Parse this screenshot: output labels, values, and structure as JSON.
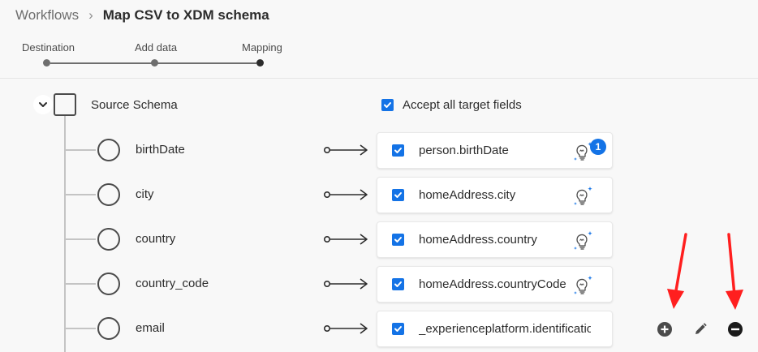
{
  "breadcrumb": {
    "root": "Workflows",
    "separator": "›",
    "current": "Map CSV to XDM schema"
  },
  "steps": [
    {
      "label": "Destination"
    },
    {
      "label": "Add data"
    },
    {
      "label": "Mapping"
    }
  ],
  "source_schema": {
    "label": "Source Schema"
  },
  "accept_all": {
    "label": "Accept all target fields",
    "checked": true
  },
  "mappings": [
    {
      "source": "birthDate",
      "target": "person.birthDate",
      "checked": true,
      "badge": "1"
    },
    {
      "source": "city",
      "target": "homeAddress.city",
      "checked": true
    },
    {
      "source": "country",
      "target": "homeAddress.country",
      "checked": true
    },
    {
      "source": "country_code",
      "target": "homeAddress.countryCode",
      "checked": true
    },
    {
      "source": "email",
      "target": "_experienceplatform.identificatior",
      "checked": true
    }
  ],
  "row_actions": [
    "add-icon",
    "edit-icon",
    "remove-icon"
  ],
  "colors": {
    "accent": "#1473e6",
    "annotation": "#ff1f1f"
  }
}
